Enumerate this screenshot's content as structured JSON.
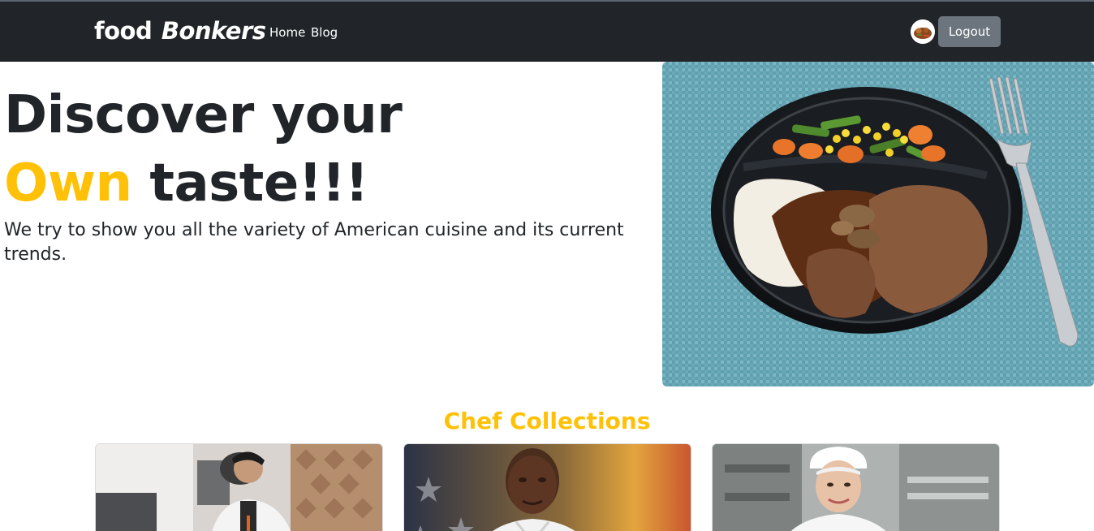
{
  "navbar": {
    "brand_part1": "food",
    "brand_part2": "Bonkers",
    "links": [
      {
        "label": "Home"
      },
      {
        "label": "Blog"
      }
    ],
    "logout_label": "Logout"
  },
  "hero": {
    "title_line1": "Discover your",
    "title_accent": "Own",
    "title_line2_rest": " taste!!!",
    "subtitle": "We try to show you all the variety of American cuisine and its current trends."
  },
  "chefs": {
    "title": "Chef Collections"
  },
  "colors": {
    "navbar_bg": "#212529",
    "accent": "#ffc107",
    "button_gray": "#6c757d"
  }
}
